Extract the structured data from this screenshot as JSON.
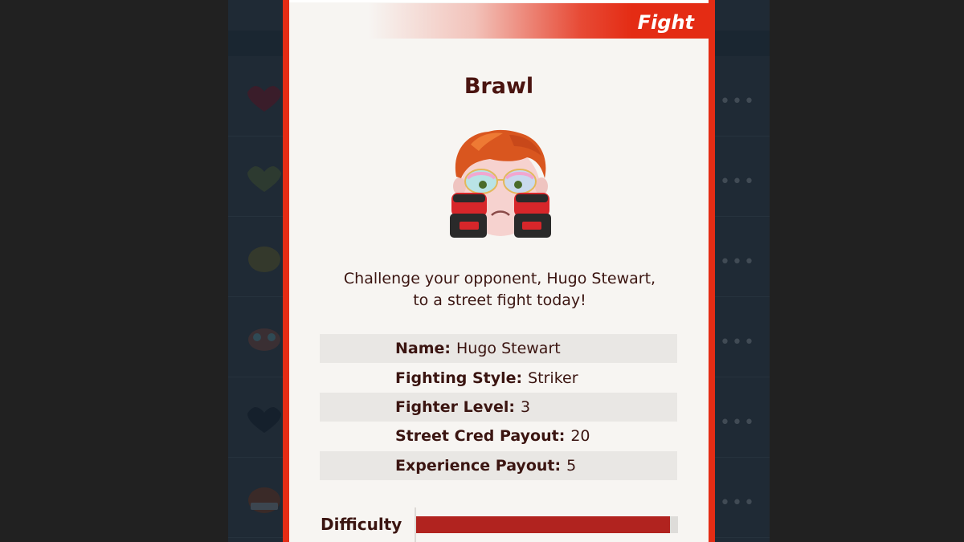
{
  "modal": {
    "tab_label": "Fight",
    "title": "Brawl",
    "description": "Challenge your opponent, Hugo Stewart, to a street fight today!",
    "avatar_icon": "fighter-avatar-icon",
    "stats": [
      {
        "label": "Name:",
        "value": "Hugo Stewart"
      },
      {
        "label": "Fighting Style:",
        "value": "Striker"
      },
      {
        "label": "Fighter Level:",
        "value": "3"
      },
      {
        "label": "Street Cred Payout:",
        "value": "20"
      },
      {
        "label": "Experience Payout:",
        "value": "5"
      }
    ],
    "difficulty": {
      "label": "Difficulty",
      "level": 0.97
    }
  },
  "background_list": {
    "items": [
      {
        "icon": "heart-icon"
      },
      {
        "icon": "heart-icon"
      },
      {
        "icon": "emoji-face-icon"
      },
      {
        "icon": "emoji-face-icon"
      },
      {
        "icon": "heart-icon"
      },
      {
        "icon": "emoji-face-icon"
      }
    ]
  },
  "colors": {
    "accent": "#e42c14",
    "difficulty_fill": "#b1231f",
    "text": "#3b1511"
  }
}
